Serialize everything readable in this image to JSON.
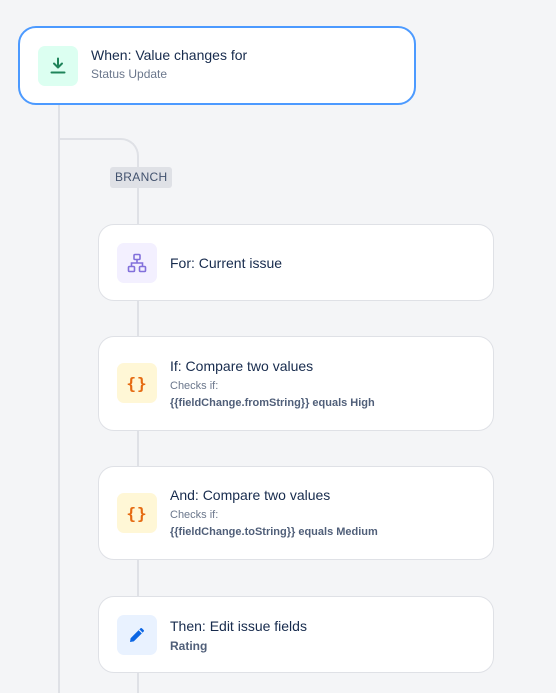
{
  "trigger": {
    "title": "When: Value changes for",
    "subtitle": "Status Update",
    "icon": "download-arrow-icon",
    "icon_color": "#1f845a"
  },
  "branch": {
    "label": "BRANCH"
  },
  "steps": [
    {
      "title": "For: Current issue",
      "icon": "hierarchy-icon",
      "icon_color": "#8270db"
    },
    {
      "title": "If: Compare two values",
      "checks_label": "Checks if:",
      "expression": "{{fieldChange.fromString}} equals High",
      "icon": "braces-icon",
      "icon_glyph": "{}",
      "icon_color": "#e56910"
    },
    {
      "title": "And: Compare two values",
      "checks_label": "Checks if:",
      "expression": "{{fieldChange.toString}} equals Medium",
      "icon": "braces-icon",
      "icon_glyph": "{}",
      "icon_color": "#e56910"
    },
    {
      "title": "Then: Edit issue fields",
      "detail": "Rating",
      "icon": "pencil-icon",
      "icon_color": "#0c66e4"
    }
  ],
  "colors": {
    "trigger_border": "#4c9aff",
    "connector": "#dfe1e6",
    "background": "#f4f5f7"
  }
}
